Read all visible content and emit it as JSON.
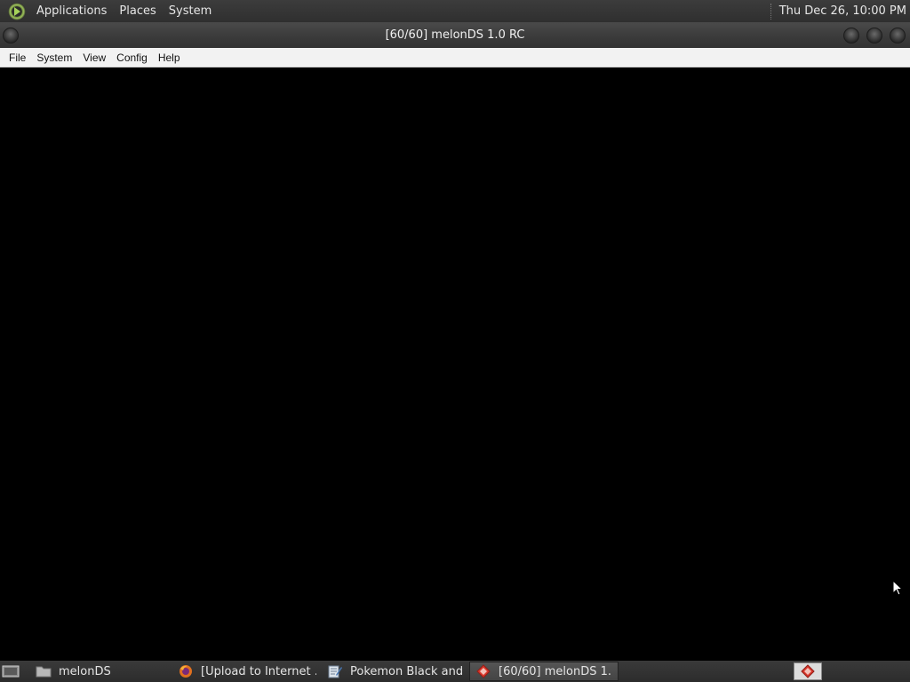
{
  "top_panel": {
    "menus": [
      "Applications",
      "Places",
      "System"
    ],
    "clock": "Thu Dec 26, 10:00 PM",
    "menu_icon": "mate-menu-icon"
  },
  "window": {
    "title": "[60/60] melonDS 1.0 RC",
    "menu": [
      "File",
      "System",
      "View",
      "Config",
      "Help"
    ]
  },
  "taskbar": {
    "tasks": [
      {
        "label": "melonDS",
        "icon": "folder-icon",
        "active": false
      },
      {
        "label": "[Upload to Internet ...",
        "icon": "firefox-icon",
        "active": false
      },
      {
        "label": "Pokemon Black and...",
        "icon": "text-editor-icon",
        "active": false
      },
      {
        "label": "[60/60] melonDS 1....",
        "icon": "melonds-icon",
        "active": true
      }
    ],
    "tray_icon": "melonds-tray-icon"
  },
  "colors": {
    "panel": "#333333",
    "menubar": "#f2f2f2",
    "screen": "#000000",
    "melonds_red": "#d9362b"
  }
}
